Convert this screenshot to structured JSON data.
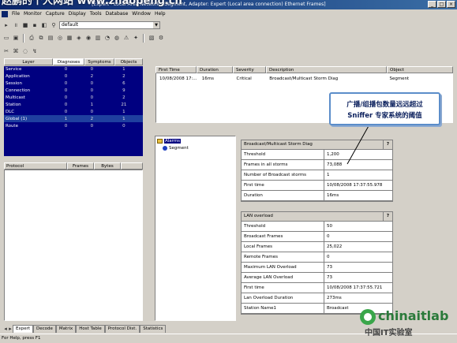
{
  "window": {
    "title": "- [Expert - Local Area Network - Segment, Adapter: Expert (Local area connection) Ethernet Frames]",
    "watermark": "赵鹏的个人网站 www.zhaopeng.cn"
  },
  "menu": [
    "File",
    "Monitor",
    "Capture",
    "Display",
    "Tools",
    "Database",
    "Window",
    "Help"
  ],
  "toolbar": {
    "profile": "default"
  },
  "left_tabs": [
    "Layer",
    "Diagnoses",
    "Symptoms",
    "Objects"
  ],
  "layers": [
    {
      "name": "Service",
      "d": "0",
      "s": "0",
      "o": "1"
    },
    {
      "name": "Application",
      "d": "0",
      "s": "2",
      "o": "2"
    },
    {
      "name": "Session",
      "d": "0",
      "s": "0",
      "o": "6"
    },
    {
      "name": "Connection",
      "d": "0",
      "s": "0",
      "o": "9"
    },
    {
      "name": "Multicast",
      "d": "0",
      "s": "0",
      "o": "2"
    },
    {
      "name": "Station",
      "d": "0",
      "s": "1",
      "o": "21"
    },
    {
      "name": "DLC",
      "d": "0",
      "s": "0",
      "o": "1"
    },
    {
      "name": "Global (1)",
      "d": "1",
      "s": "2",
      "o": "1"
    },
    {
      "name": "Route",
      "d": "0",
      "s": "0",
      "o": "0"
    }
  ],
  "protocol_cols": [
    "Protocol",
    "Frames",
    "Bytes"
  ],
  "event_cols": [
    "First Time",
    "Duration",
    "Severity",
    "Description",
    "Object"
  ],
  "events": [
    {
      "time": "10/08/2008 17:...",
      "duration": "16ms",
      "severity": "Critical",
      "desc": "Broadcast/Multicast Storm Diag",
      "object": "Segment"
    }
  ],
  "tree": {
    "root": "Alarms",
    "child": "Segment"
  },
  "callout": {
    "line1": "广播/组播包数量远远超过",
    "line2": "Sniffer 专家系统的阈值"
  },
  "storm": {
    "title": "Broadcast/Multicast Storm Diag",
    "rows": [
      {
        "k": "Threshold",
        "v": "1,200"
      },
      {
        "k": "Frames in all storms",
        "v": "73,088"
      },
      {
        "k": "Number of Broadcast storms",
        "v": "1"
      },
      {
        "k": "First time",
        "v": "10/08/2008 17:37:55.978"
      },
      {
        "k": "Duration",
        "v": "16ms"
      }
    ]
  },
  "lan": {
    "title": "LAN overload",
    "rows": [
      {
        "k": "Threshold",
        "v": "50"
      },
      {
        "k": "Broadcast Frames",
        "v": "0"
      },
      {
        "k": "Local Frames",
        "v": "25,022"
      },
      {
        "k": "Remote Frames",
        "v": "0"
      },
      {
        "k": "Maximum LAN Overload",
        "v": "73"
      },
      {
        "k": "Average LAN Overload",
        "v": "73"
      },
      {
        "k": "First time",
        "v": "10/08/2008 17:37:55.721"
      },
      {
        "k": "Lan Overload Duration",
        "v": "273ms"
      },
      {
        "k": "Station Name1",
        "v": "Broadcast"
      }
    ]
  },
  "bottom_tabs": [
    "Expert",
    "Decode",
    "Matrix",
    "Host Table",
    "Protocol Dist.",
    "Statistics"
  ],
  "status": "For Help, press F1",
  "logo": {
    "brand": "chinaitlab",
    "sub": "中国IT实验室"
  }
}
